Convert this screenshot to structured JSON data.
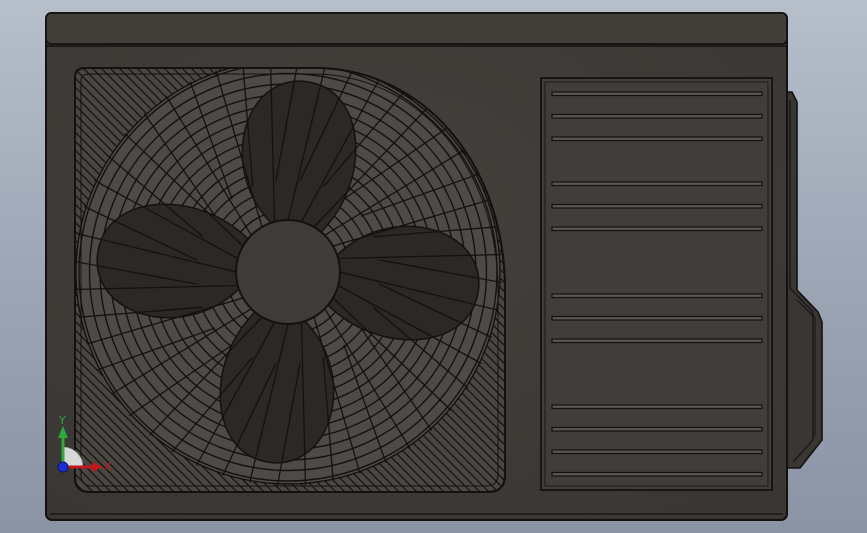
{
  "scene": {
    "object": "outdoor-air-conditioner-unit",
    "view": "front",
    "colors": {
      "background_top": "#b7bfcb",
      "background_bottom": "#8a94a4",
      "body": "#3f3b38",
      "edge": "#141210",
      "grille": "#57534f",
      "blade": "#2b2826",
      "hub": "#3f3b38"
    },
    "fan": {
      "blade_count": 4
    },
    "vent_panel": {
      "slat_groups": [
        3,
        3,
        3,
        4
      ]
    }
  },
  "triad": {
    "x_label": "X",
    "y_label": "Y",
    "colors": {
      "x": "#c0171c",
      "y": "#2fa83c",
      "z": "#1c2fd0"
    }
  }
}
